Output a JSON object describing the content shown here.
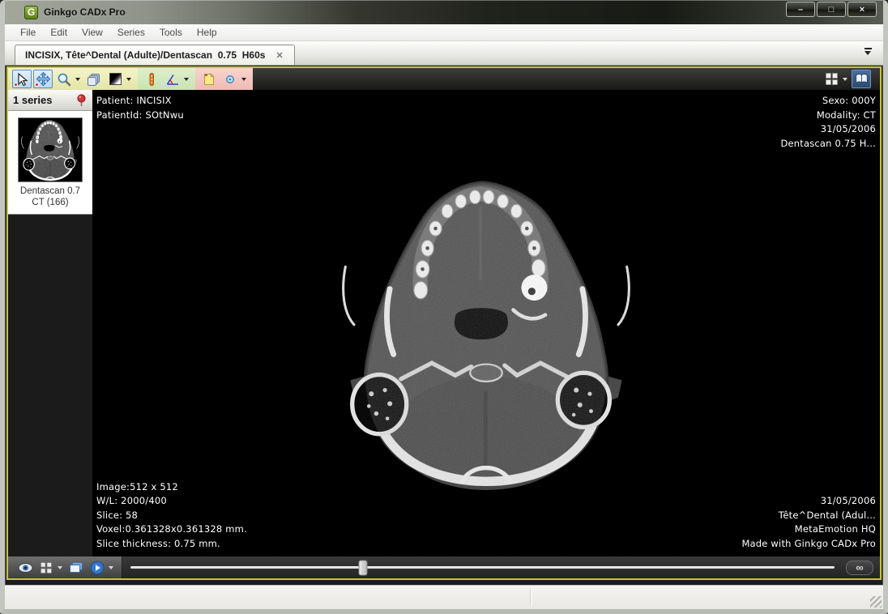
{
  "window": {
    "title": "Ginkgo CADx Pro",
    "icon_letter": "G",
    "controls": {
      "minimize": "–",
      "maximize": "□",
      "close": "×"
    }
  },
  "menu": {
    "items": [
      "File",
      "Edit",
      "View",
      "Series",
      "Tools",
      "Help"
    ]
  },
  "tabbar": {
    "active_tab": "INCISIX, Tête^Dental (Adulte)/Dentascan  0.75  H60s",
    "close_glyph": "✕"
  },
  "toolbar": {
    "tools": [
      "pointer-tool",
      "pan-tool",
      "zoom-tool",
      "stack-tool",
      "window-level-tool",
      "ruler-tool",
      "angle-tool",
      "note-tool",
      "marker-tool"
    ],
    "right_tools": [
      "layout-grid",
      "dicom-book"
    ]
  },
  "sidebar": {
    "header": "1 series",
    "series": [
      {
        "name": "Dentascan  0.7",
        "detail": "CT (166)"
      }
    ]
  },
  "viewer": {
    "top_left": [
      "Patient: INCISIX",
      "PatientId: SOtNwu"
    ],
    "top_right": [
      "Sexo: 000Y",
      "Modality: CT",
      "31/05/2006",
      "Dentascan 0.75 H..."
    ],
    "bottom_left": [
      "Image:512 x 512",
      "W/L: 2000/400",
      "Slice: 58",
      "Voxel:0.361328x0.361328 mm.",
      "Slice thickness: 0.75 mm."
    ],
    "bottom_right": [
      "31/05/2006",
      "Tête^Dental (Adul...",
      "MetaEmotion HQ",
      "Made with Ginkgo CADx Pro"
    ]
  },
  "bottom_bar": {
    "slider_pct": 33,
    "link_glyph": "∞",
    "icons": [
      "visibility-eye",
      "layout-grid",
      "series-frames",
      "play-cine",
      "link-series"
    ]
  },
  "colors": {
    "focus_border": "#c6c636",
    "toolbar_yellow": "#f0f1bc",
    "toolbar_green": "#d6ecc2",
    "toolbar_pink": "#f4ccc5",
    "selected_tool_bg": "#cde2f6",
    "selected_tool_border": "#5a8ac6",
    "overlay_text": "#ffffff"
  }
}
